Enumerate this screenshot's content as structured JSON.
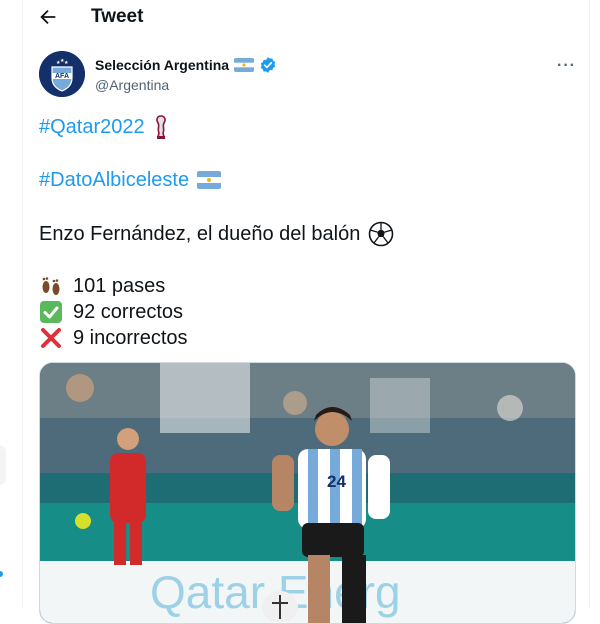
{
  "header": {
    "title": "Tweet"
  },
  "author": {
    "name": "Selección Argentina",
    "handle": "@Argentina",
    "avatar_text": "AFA"
  },
  "tweet": {
    "hashtag1": "#Qatar2022",
    "hashtag2": "#DatoAlbiceleste",
    "line_main": "Enzo Fernández, el dueño del balón",
    "stat_passes": "101 pases",
    "stat_correct": "92 correctos",
    "stat_incorrect": "9 incorrectos"
  },
  "photo": {
    "shirt_number": "24",
    "banner_text": "Qatar Energ"
  },
  "icons": {
    "back": "arrow-left-icon",
    "verified": "verified-badge-icon",
    "flag": "argentina-flag-icon",
    "trophy": "world-cup-trophy-icon",
    "ball": "soccer-ball-icon",
    "footprints": "footprints-icon",
    "check": "check-mark-icon",
    "cross": "cross-mark-icon",
    "more": "more-options-icon"
  },
  "colors": {
    "accent": "#1d9bf0",
    "text": "#0f1419",
    "muted": "#536471",
    "afa_navy": "#14306a",
    "sky_blue": "#75aadb"
  }
}
